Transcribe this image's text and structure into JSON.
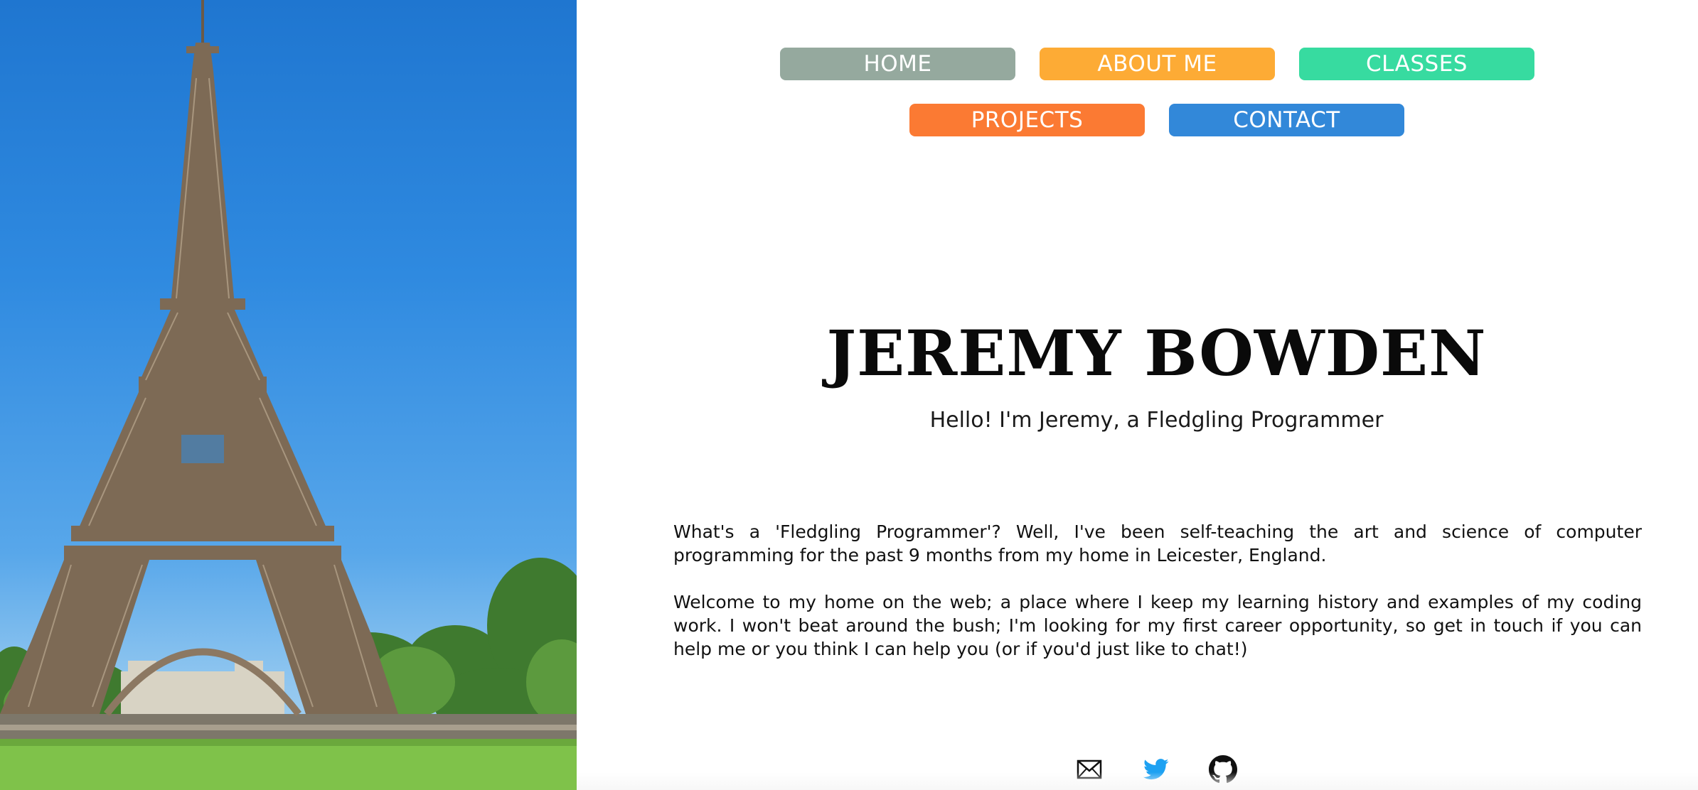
{
  "nav": {
    "items": [
      {
        "label": "HOME",
        "color": "#95a99e"
      },
      {
        "label": "ABOUT ME",
        "color": "#fdab35"
      },
      {
        "label": "CLASSES",
        "color": "#37dba0"
      },
      {
        "label": "PROJECTS",
        "color": "#fb7a33"
      },
      {
        "label": "CONTACT",
        "color": "#3288d9"
      }
    ]
  },
  "hero": {
    "icon": "eiffel-tower-image"
  },
  "header": {
    "title": "JEREMY BOWDEN",
    "subtitle": "Hello! I'm Jeremy, a Fledgling Programmer"
  },
  "bio": {
    "paragraphs": [
      "What's a 'Fledgling Programmer'? Well, I've been self-teaching the art and science of computer programming for the past 9 months from my home in Leicester, England.",
      "Welcome to my home on the web; a place where I keep my learning history and examples of my coding work. I won't beat around the bush; I'm looking for my first career opportunity, so get in touch if you can help me or you think I can help you (or if you'd just like to chat!)"
    ]
  },
  "social": {
    "links": [
      {
        "icon": "envelope-icon",
        "color": "#111111"
      },
      {
        "icon": "twitter-icon",
        "color": "#1da1f2"
      },
      {
        "icon": "github-icon",
        "color": "#111111"
      }
    ]
  }
}
